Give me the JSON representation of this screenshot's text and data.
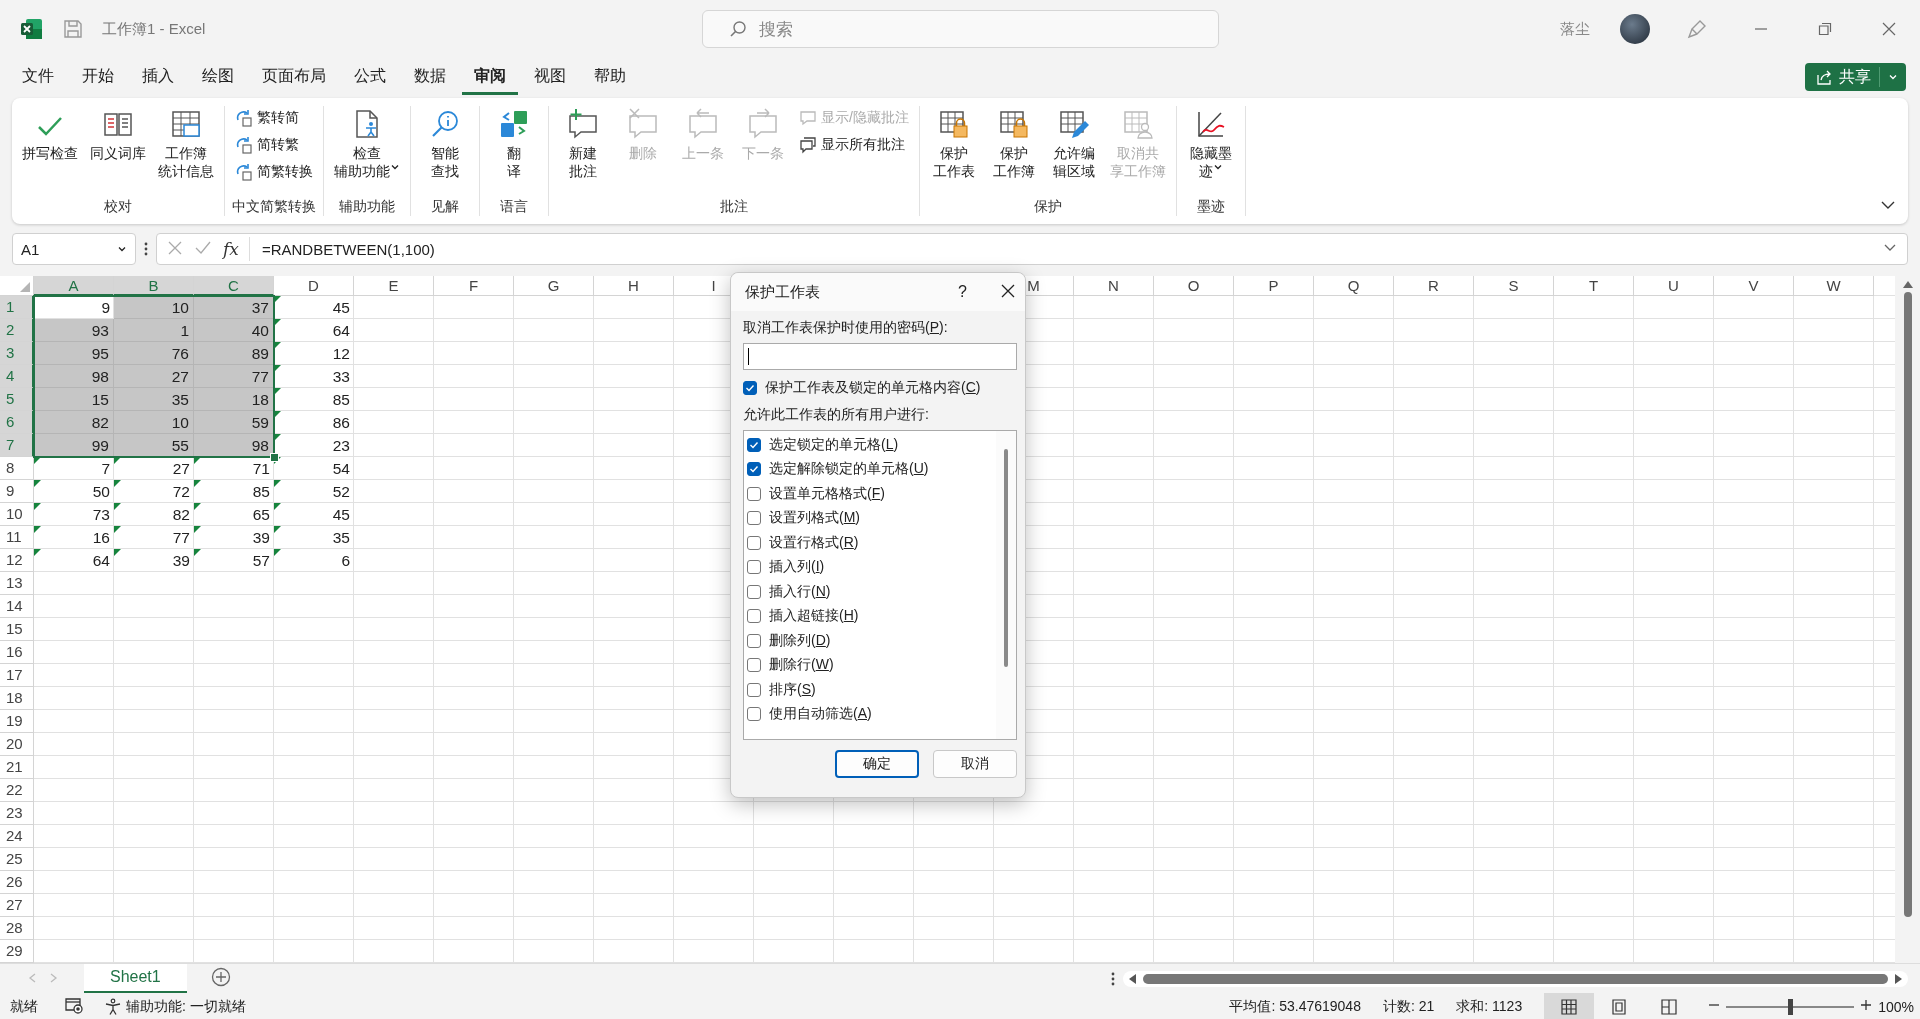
{
  "window": {
    "title": "工作簿1 - Excel",
    "search_placeholder": "搜索",
    "user_name": "落尘"
  },
  "tabs": [
    {
      "label": "文件",
      "selected": false
    },
    {
      "label": "开始",
      "selected": false
    },
    {
      "label": "插入",
      "selected": false
    },
    {
      "label": "绘图",
      "selected": false
    },
    {
      "label": "页面布局",
      "selected": false
    },
    {
      "label": "公式",
      "selected": false
    },
    {
      "label": "数据",
      "selected": false
    },
    {
      "label": "审阅",
      "selected": true
    },
    {
      "label": "视图",
      "selected": false
    },
    {
      "label": "帮助",
      "selected": false
    }
  ],
  "share_button": {
    "label": "共享"
  },
  "ribbon": {
    "groups": [
      {
        "label": "校对",
        "items": [
          {
            "kind": "large",
            "lines": [
              "拼写检查"
            ],
            "disabled": false,
            "caret": false
          },
          {
            "kind": "large",
            "lines": [
              "同义词库"
            ],
            "disabled": false,
            "caret": false
          },
          {
            "kind": "large",
            "lines": [
              "工作簿",
              "统计信息"
            ],
            "disabled": false,
            "caret": false
          }
        ]
      },
      {
        "label": "中文简繁转换",
        "items": [
          {
            "kind": "stack",
            "items": [
              {
                "label": "繁转简",
                "disabled": false
              },
              {
                "label": "简转繁",
                "disabled": false
              },
              {
                "label": "简繁转换",
                "disabled": false
              }
            ]
          }
        ]
      },
      {
        "label": "辅助功能",
        "items": [
          {
            "kind": "large",
            "lines": [
              "检查",
              "辅助功能"
            ],
            "disabled": false,
            "caret": true
          }
        ]
      },
      {
        "label": "见解",
        "items": [
          {
            "kind": "large",
            "lines": [
              "智能",
              "查找"
            ],
            "disabled": false,
            "caret": false
          }
        ]
      },
      {
        "label": "语言",
        "items": [
          {
            "kind": "large",
            "lines": [
              "翻",
              "译"
            ],
            "disabled": false,
            "caret": false
          }
        ]
      },
      {
        "label": "批注",
        "items": [
          {
            "kind": "large",
            "lines": [
              "新建",
              "批注"
            ],
            "disabled": false,
            "caret": false
          },
          {
            "kind": "large",
            "lines": [
              "删除"
            ],
            "disabled": true,
            "caret": false
          },
          {
            "kind": "large",
            "lines": [
              "上一条"
            ],
            "disabled": true,
            "caret": false
          },
          {
            "kind": "large",
            "lines": [
              "下一条"
            ],
            "disabled": true,
            "caret": false
          },
          {
            "kind": "stack",
            "items": [
              {
                "label": "显示/隐藏批注",
                "disabled": true
              },
              {
                "label": "显示所有批注",
                "disabled": false
              }
            ]
          }
        ]
      },
      {
        "label": "保护",
        "items": [
          {
            "kind": "large",
            "lines": [
              "保护",
              "工作表"
            ],
            "disabled": false,
            "caret": false
          },
          {
            "kind": "large",
            "lines": [
              "保护",
              "工作簿"
            ],
            "disabled": false,
            "caret": false
          },
          {
            "kind": "large",
            "lines": [
              "允许编",
              "辑区域"
            ],
            "disabled": false,
            "caret": false
          },
          {
            "kind": "large",
            "lines": [
              "取消共",
              "享工作簿"
            ],
            "disabled": true,
            "caret": false
          }
        ]
      },
      {
        "label": "墨迹",
        "items": [
          {
            "kind": "large",
            "lines": [
              "隐藏墨",
              "迹"
            ],
            "disabled": false,
            "caret": true
          }
        ]
      }
    ]
  },
  "formula_bar": {
    "name_box": "A1",
    "fx": "fx",
    "formula": "=RANDBETWEEN(1,100)"
  },
  "grid": {
    "columns_left": [
      "A",
      "B",
      "C",
      "D",
      "E",
      "F",
      "G",
      "H",
      "I"
    ],
    "columns_right": [
      "M",
      "N",
      "O",
      "P",
      "Q",
      "R",
      "S",
      "T",
      "U",
      "V",
      "W"
    ],
    "rows": [
      {
        "header": "1",
        "cells": [
          {
            "value": "9",
            "selected": false,
            "flag": false
          },
          {
            "value": "10",
            "selected": true,
            "flag": false
          },
          {
            "value": "37",
            "selected": true,
            "flag": false
          },
          {
            "value": "45",
            "selected": false,
            "flag": true
          }
        ]
      },
      {
        "header": "2",
        "cells": [
          {
            "value": "93",
            "selected": true,
            "flag": false
          },
          {
            "value": "1",
            "selected": true,
            "flag": false
          },
          {
            "value": "40",
            "selected": true,
            "flag": false
          },
          {
            "value": "64",
            "selected": false,
            "flag": true
          }
        ]
      },
      {
        "header": "3",
        "cells": [
          {
            "value": "95",
            "selected": true,
            "flag": false
          },
          {
            "value": "76",
            "selected": true,
            "flag": false
          },
          {
            "value": "89",
            "selected": true,
            "flag": false
          },
          {
            "value": "12",
            "selected": false,
            "flag": true
          }
        ]
      },
      {
        "header": "4",
        "cells": [
          {
            "value": "98",
            "selected": true,
            "flag": false
          },
          {
            "value": "27",
            "selected": true,
            "flag": false
          },
          {
            "value": "77",
            "selected": true,
            "flag": false
          },
          {
            "value": "33",
            "selected": false,
            "flag": true
          }
        ]
      },
      {
        "header": "5",
        "cells": [
          {
            "value": "15",
            "selected": true,
            "flag": false
          },
          {
            "value": "35",
            "selected": true,
            "flag": false
          },
          {
            "value": "18",
            "selected": true,
            "flag": false
          },
          {
            "value": "85",
            "selected": false,
            "flag": true
          }
        ]
      },
      {
        "header": "6",
        "cells": [
          {
            "value": "82",
            "selected": true,
            "flag": false
          },
          {
            "value": "10",
            "selected": true,
            "flag": false
          },
          {
            "value": "59",
            "selected": true,
            "flag": false
          },
          {
            "value": "86",
            "selected": false,
            "flag": true
          }
        ]
      },
      {
        "header": "7",
        "cells": [
          {
            "value": "99",
            "selected": true,
            "flag": false
          },
          {
            "value": "55",
            "selected": true,
            "flag": false
          },
          {
            "value": "98",
            "selected": true,
            "flag": false
          },
          {
            "value": "23",
            "selected": false,
            "flag": true
          }
        ]
      },
      {
        "header": "8",
        "cells": [
          {
            "value": "7",
            "selected": false,
            "flag": true
          },
          {
            "value": "27",
            "selected": false,
            "flag": true
          },
          {
            "value": "71",
            "selected": false,
            "flag": true
          },
          {
            "value": "54",
            "selected": false,
            "flag": true
          }
        ]
      },
      {
        "header": "9",
        "cells": [
          {
            "value": "50",
            "selected": false,
            "flag": true
          },
          {
            "value": "72",
            "selected": false,
            "flag": true
          },
          {
            "value": "85",
            "selected": false,
            "flag": true
          },
          {
            "value": "52",
            "selected": false,
            "flag": true
          }
        ]
      },
      {
        "header": "10",
        "cells": [
          {
            "value": "73",
            "selected": false,
            "flag": true
          },
          {
            "value": "82",
            "selected": false,
            "flag": true
          },
          {
            "value": "65",
            "selected": false,
            "flag": true
          },
          {
            "value": "45",
            "selected": false,
            "flag": true
          }
        ]
      },
      {
        "header": "11",
        "cells": [
          {
            "value": "16",
            "selected": false,
            "flag": true
          },
          {
            "value": "77",
            "selected": false,
            "flag": true
          },
          {
            "value": "39",
            "selected": false,
            "flag": true
          },
          {
            "value": "35",
            "selected": false,
            "flag": true
          }
        ]
      },
      {
        "header": "12",
        "cells": [
          {
            "value": "64",
            "selected": false,
            "flag": true
          },
          {
            "value": "39",
            "selected": false,
            "flag": true
          },
          {
            "value": "57",
            "selected": false,
            "flag": true
          },
          {
            "value": "6",
            "selected": false,
            "flag": true
          }
        ]
      },
      {
        "header": "13"
      },
      {
        "header": "14"
      },
      {
        "header": "15"
      },
      {
        "header": "16"
      },
      {
        "header": "17"
      },
      {
        "header": "18"
      },
      {
        "header": "19"
      },
      {
        "header": "20"
      },
      {
        "header": "21"
      },
      {
        "header": "22"
      },
      {
        "header": "23"
      },
      {
        "header": "24"
      },
      {
        "header": "25"
      },
      {
        "header": "26"
      },
      {
        "header": "27"
      },
      {
        "header": "28"
      },
      {
        "header": "29"
      }
    ]
  },
  "sheet_tabs": [
    {
      "label": "Sheet1",
      "selected": true
    }
  ],
  "status_bar": {
    "ready": "就绪",
    "accessibility": "辅助功能: 一切就绪",
    "average": "平均值: 53.47619048",
    "count": "计数: 21",
    "sum": "求和: 1123",
    "views": [
      {
        "kind": "normal",
        "selected": true
      },
      {
        "kind": "page_layout",
        "selected": false
      },
      {
        "kind": "page_break",
        "selected": false
      }
    ],
    "zoom": {
      "level": 0.5,
      "reading": "100%"
    }
  },
  "dialog": {
    "title": "保护工作表",
    "help": "?",
    "password_label": [
      "取消工作表保护时使用的密码(",
      "P",
      "):"
    ],
    "protect_checkbox": {
      "label": [
        "保护工作表及锁定的单元格内容(",
        "C",
        ")"
      ],
      "checked": true
    },
    "allow_label": "允许此工作表的所有用户进行:",
    "options": [
      {
        "label": [
          "选定锁定的单元格(",
          "L",
          ")"
        ],
        "checked": true
      },
      {
        "label": [
          "选定解除锁定的单元格(",
          "U",
          ")"
        ],
        "checked": true
      },
      {
        "label": [
          "设置单元格格式(",
          "F",
          ")"
        ],
        "checked": false
      },
      {
        "label": [
          "设置列格式(",
          "M",
          ")"
        ],
        "checked": false
      },
      {
        "label": [
          "设置行格式(",
          "R",
          ")"
        ],
        "checked": false
      },
      {
        "label": [
          "插入列(",
          "I",
          ")"
        ],
        "checked": false
      },
      {
        "label": [
          "插入行(",
          "N",
          ")"
        ],
        "checked": false
      },
      {
        "label": [
          "插入超链接(",
          "H",
          ")"
        ],
        "checked": false
      },
      {
        "label": [
          "删除列(",
          "D",
          ")"
        ],
        "checked": false
      },
      {
        "label": [
          "删除行(",
          "W",
          ")"
        ],
        "checked": false
      },
      {
        "label": [
          "排序(",
          "S",
          ")"
        ],
        "checked": false
      },
      {
        "label": [
          "使用自动筛选(",
          "A",
          ")"
        ],
        "checked": false
      }
    ],
    "ok": "确定",
    "cancel": "取消"
  }
}
